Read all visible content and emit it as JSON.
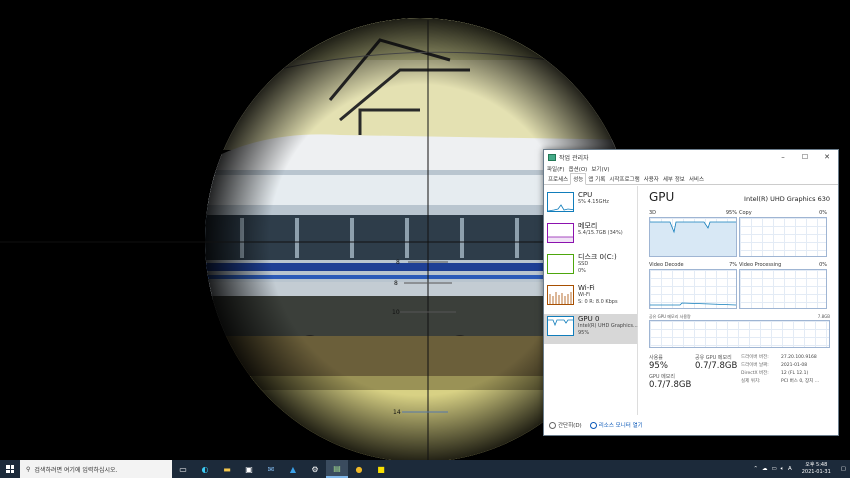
{
  "scope": {
    "reticle_marks": [
      "8",
      "8",
      "10",
      "14"
    ]
  },
  "task_manager": {
    "title": "작업 관리자",
    "window_controls": {
      "minimize": "–",
      "maximize": "☐",
      "close": "✕"
    },
    "menu": [
      "파일(F)",
      "옵션(O)",
      "보기(V)"
    ],
    "tabs": [
      "프로세스",
      "성능",
      "앱 기록",
      "시작프로그램",
      "사용자",
      "세부 정보",
      "서비스"
    ],
    "active_tab": "성능",
    "resources": [
      {
        "name": "CPU",
        "sub": "5% 4.15GHz",
        "color": "#117dbb"
      },
      {
        "name": "메모리",
        "sub": "5.4/15.7GB (34%)",
        "color": "#8b12ae"
      },
      {
        "name": "디스크 0(C:)",
        "sub": "SSD",
        "sub2": "0%",
        "color": "#4da60c"
      },
      {
        "name": "Wi-Fi",
        "sub": "Wi-Fi",
        "sub2": "S: 0 R: 8.0 Kbps",
        "color": "#a74f01"
      },
      {
        "name": "GPU 0",
        "sub": "Intel(R) UHD Graphics...",
        "sub2": "95%",
        "color": "#117dbb"
      }
    ],
    "gpu": {
      "title": "GPU",
      "model": "Intel(R) UHD Graphics 630",
      "engines": [
        {
          "name": "3D",
          "pct": "95%"
        },
        {
          "name": "Copy",
          "pct": "0%"
        },
        {
          "name": "Video Decode",
          "pct": "7%"
        },
        {
          "name": "Video Processing",
          "pct": "0%"
        }
      ],
      "shared_mem_label": "공유 GPU 메모리 사용량",
      "shared_mem_max": "7.8GB",
      "stats": {
        "utilization_label": "사용률",
        "utilization": "95%",
        "shared_label": "공유 GPU 메모리",
        "shared": "0.7/7.8GB",
        "gpu_mem_label": "GPU 메모리",
        "gpu_mem": "0.7/7.8GB"
      },
      "details": [
        {
          "k": "드라이버 버전:",
          "v": "27.20.100.9168"
        },
        {
          "k": "드라이버 날짜:",
          "v": "2021-01-08"
        },
        {
          "k": "DirectX 버전:",
          "v": "12 (FL 12.1)"
        },
        {
          "k": "실제 위치:",
          "v": "PCI 버스 0, 장치 ..."
        }
      ]
    },
    "footer": {
      "less_details": "간단히(D)",
      "resource_monitor": "리소스 모니터 열기"
    }
  },
  "taskbar": {
    "search_placeholder": "검색하려면 여기에 입력하십시오.",
    "apps": [
      "task-view",
      "edge",
      "file-explorer",
      "store",
      "mail",
      "app-blue",
      "settings",
      "task-manager",
      "chrome",
      "kakaotalk"
    ],
    "tray": {
      "ime": "A",
      "time_line1": "오후 5:48",
      "time_line2": "2021-01-31"
    }
  }
}
